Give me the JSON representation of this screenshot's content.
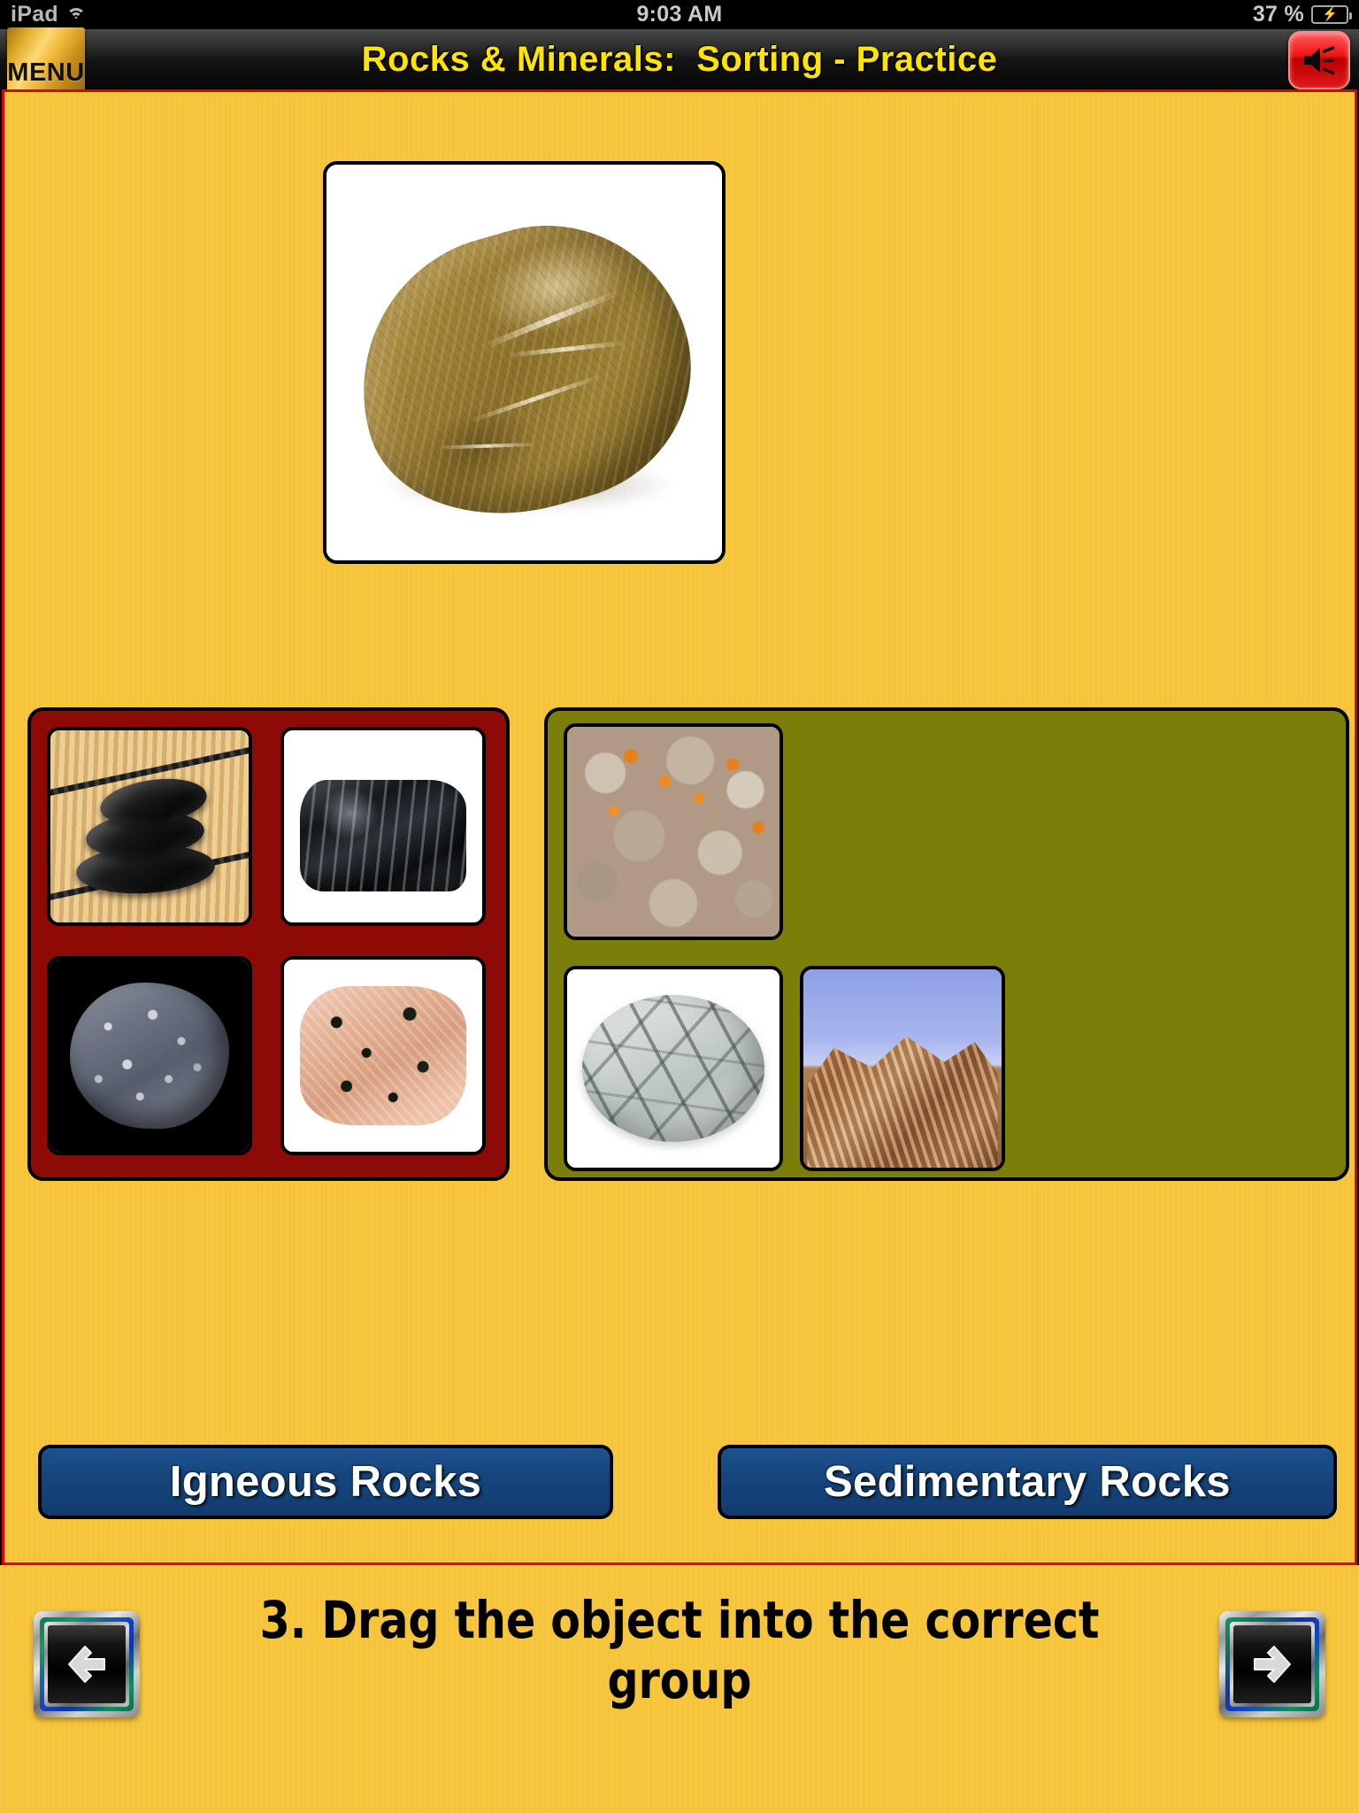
{
  "status_bar": {
    "device": "iPad",
    "wifi_icon": "wifi-icon",
    "time": "9:03 AM",
    "battery_percent": "37 %",
    "battery_icon": "battery-charging-icon"
  },
  "title_bar": {
    "menu_label": "MENU",
    "title": "Rocks & Minerals:  Sorting - Practice",
    "sound_icon": "speaker-on-icon"
  },
  "main": {
    "object_card": {
      "name": "sandstone-pebble-photo",
      "alt": "Brown sandstone pebble on white background"
    },
    "groups": [
      {
        "id": "igneous",
        "label": "Igneous Rocks",
        "color": "#8E0A06",
        "items": [
          {
            "name": "basalt-zen-stones-photo"
          },
          {
            "name": "obsidian-chunk-photo"
          },
          {
            "name": "porphyry-pebble-photo"
          },
          {
            "name": "granite-chunk-photo"
          }
        ]
      },
      {
        "id": "sedimentary",
        "label": "Sedimentary Rocks",
        "color": "#7B7E09",
        "items": [
          {
            "name": "conglomerate-outcrop-photo"
          },
          {
            "name": "marble-pebble-photo"
          },
          {
            "name": "sandstone-cliff-photo"
          }
        ]
      }
    ]
  },
  "footer": {
    "instruction_line1": "3. Drag the object into the correct",
    "instruction_line2": "group",
    "prev_icon": "arrow-left-icon",
    "next_icon": "arrow-right-icon"
  },
  "colors": {
    "background": "#F5C438",
    "frame_border": "#E00000",
    "title_text": "#FFE400",
    "label_button": "#16457D",
    "igneous_group": "#8E0A06",
    "sedimentary_group": "#7B7E09"
  }
}
